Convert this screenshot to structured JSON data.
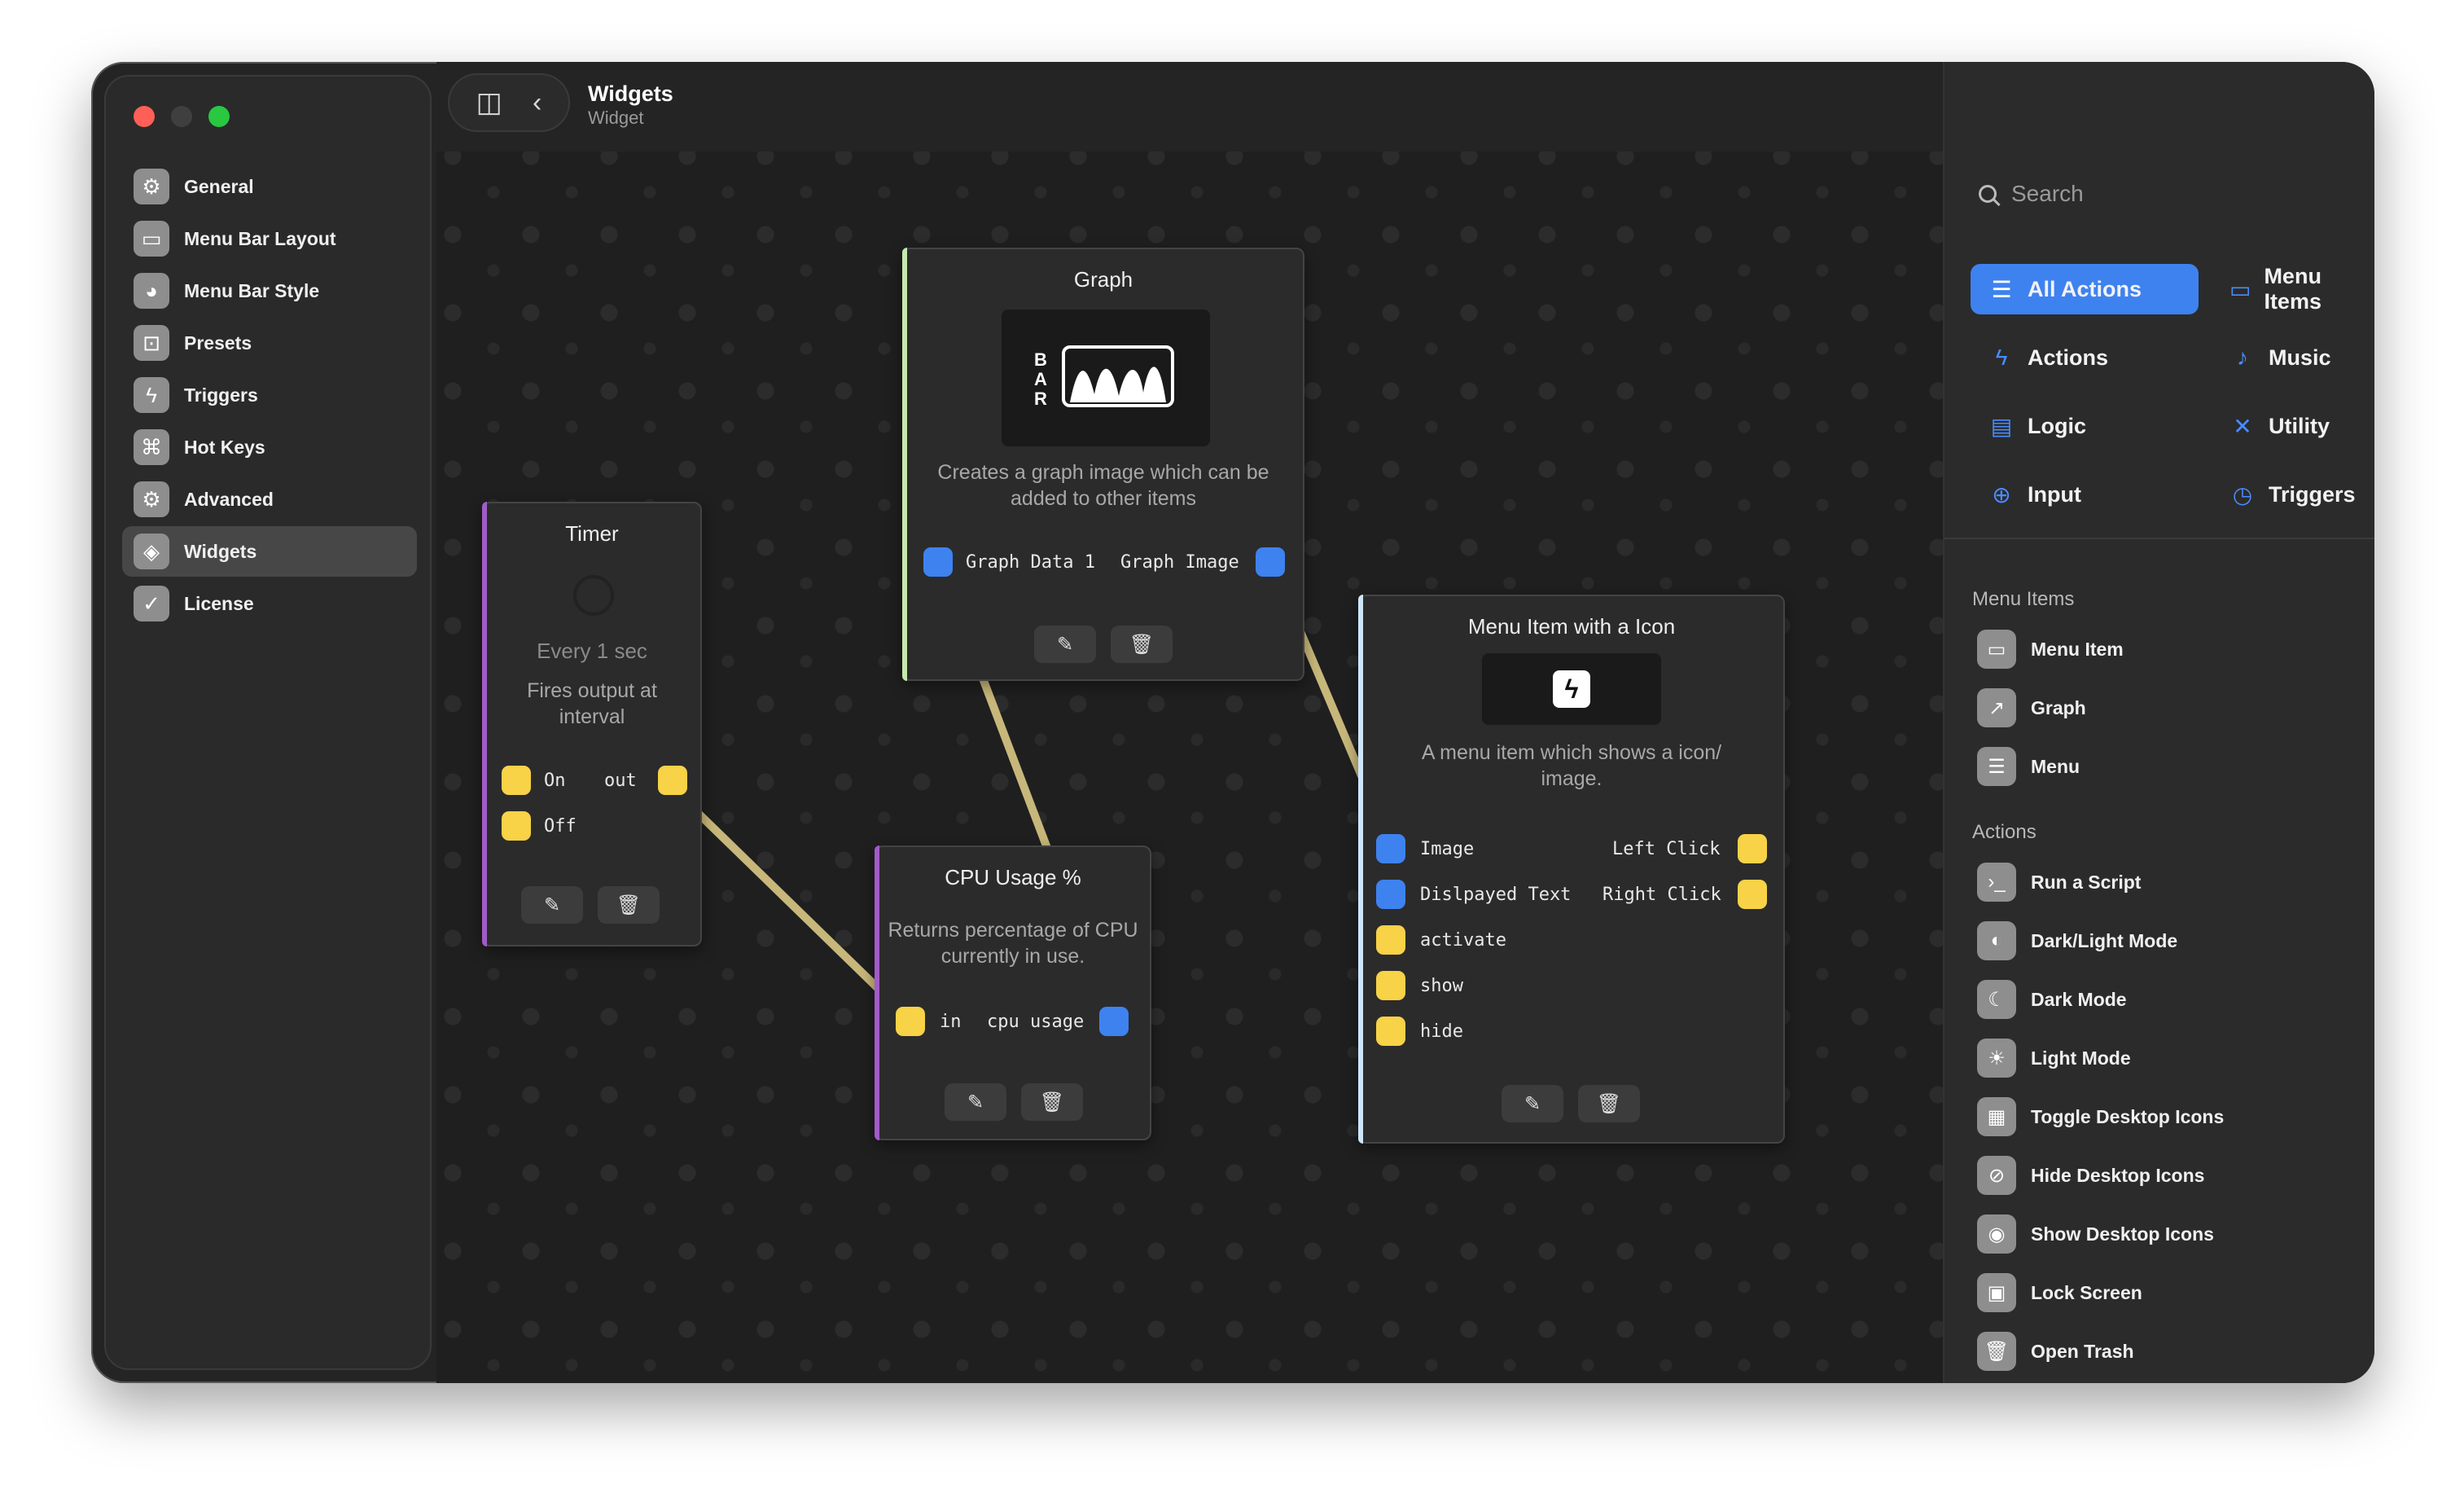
{
  "window": {
    "title": "Widgets",
    "subtitle": "Widget"
  },
  "sidebar": {
    "items": [
      {
        "label": "General",
        "icon": "gear-icon"
      },
      {
        "label": "Menu Bar Layout",
        "icon": "window-icon"
      },
      {
        "label": "Menu Bar Style",
        "icon": "palette-icon"
      },
      {
        "label": "Presets",
        "icon": "preset-icon"
      },
      {
        "label": "Triggers",
        "icon": "bolt-icon"
      },
      {
        "label": "Hot Keys",
        "icon": "command-icon"
      },
      {
        "label": "Advanced",
        "icon": "gears-icon"
      },
      {
        "label": "Widgets",
        "icon": "cube-icon"
      },
      {
        "label": "License",
        "icon": "badge-check-icon"
      }
    ],
    "active": "Widgets"
  },
  "nodes": {
    "timer": {
      "title": "Timer",
      "interval": "Every 1 sec",
      "desc": "Fires output at interval",
      "ports": {
        "on": "On",
        "off": "Off",
        "out": "out"
      },
      "accent": "#a05cc8"
    },
    "graph": {
      "title": "Graph",
      "desc": "Creates a graph image which can be added to other items",
      "ports": {
        "in": "Graph Data 1",
        "out": "Graph Image"
      },
      "preview_letters": [
        "B",
        "A",
        "R"
      ],
      "accent": "#c6e8b0"
    },
    "cpu": {
      "title": "CPU Usage %",
      "desc": "Returns percentage of CPU currently in use.",
      "ports": {
        "in": "in",
        "out": "cpu usage"
      },
      "accent": "#a05cc8"
    },
    "menu_item": {
      "title": "Menu Item with a Icon",
      "desc": "A menu item which shows a icon/ image.",
      "ports": {
        "image": "Image",
        "text": "Dislpayed Text",
        "activate": "activate",
        "show": "show",
        "hide": "hide",
        "left_click": "Left Click",
        "right_click": "Right Click"
      },
      "accent": "#cfe6f8"
    }
  },
  "colors": {
    "port_yellow": "#f8d247",
    "port_blue": "#3e82f0",
    "wire": "#c7b77a",
    "accent_blue": "#3e82f0"
  },
  "panel": {
    "search_placeholder": "Search",
    "categories": [
      {
        "label": "All Actions",
        "icon": "list-icon",
        "active": true
      },
      {
        "label": "Menu Items",
        "icon": "window-icon"
      },
      {
        "label": "Actions",
        "icon": "bolt-icon"
      },
      {
        "label": "Music",
        "icon": "music-note-icon"
      },
      {
        "label": "Logic",
        "icon": "logic-icon"
      },
      {
        "label": "Utility",
        "icon": "tools-icon"
      },
      {
        "label": "Input",
        "icon": "input-icon"
      },
      {
        "label": "Triggers",
        "icon": "timer-icon"
      }
    ],
    "sections": [
      {
        "title": "Menu Items",
        "items": [
          "Menu Item",
          "Graph",
          "Menu"
        ]
      },
      {
        "title": "Actions",
        "items": [
          "Run a Script",
          "Dark/Light Mode",
          "Dark Mode",
          "Light Mode",
          "Toggle Desktop Icons",
          "Hide Desktop Icons",
          "Show Desktop Icons",
          "Lock Screen",
          "Open Trash"
        ]
      }
    ]
  }
}
